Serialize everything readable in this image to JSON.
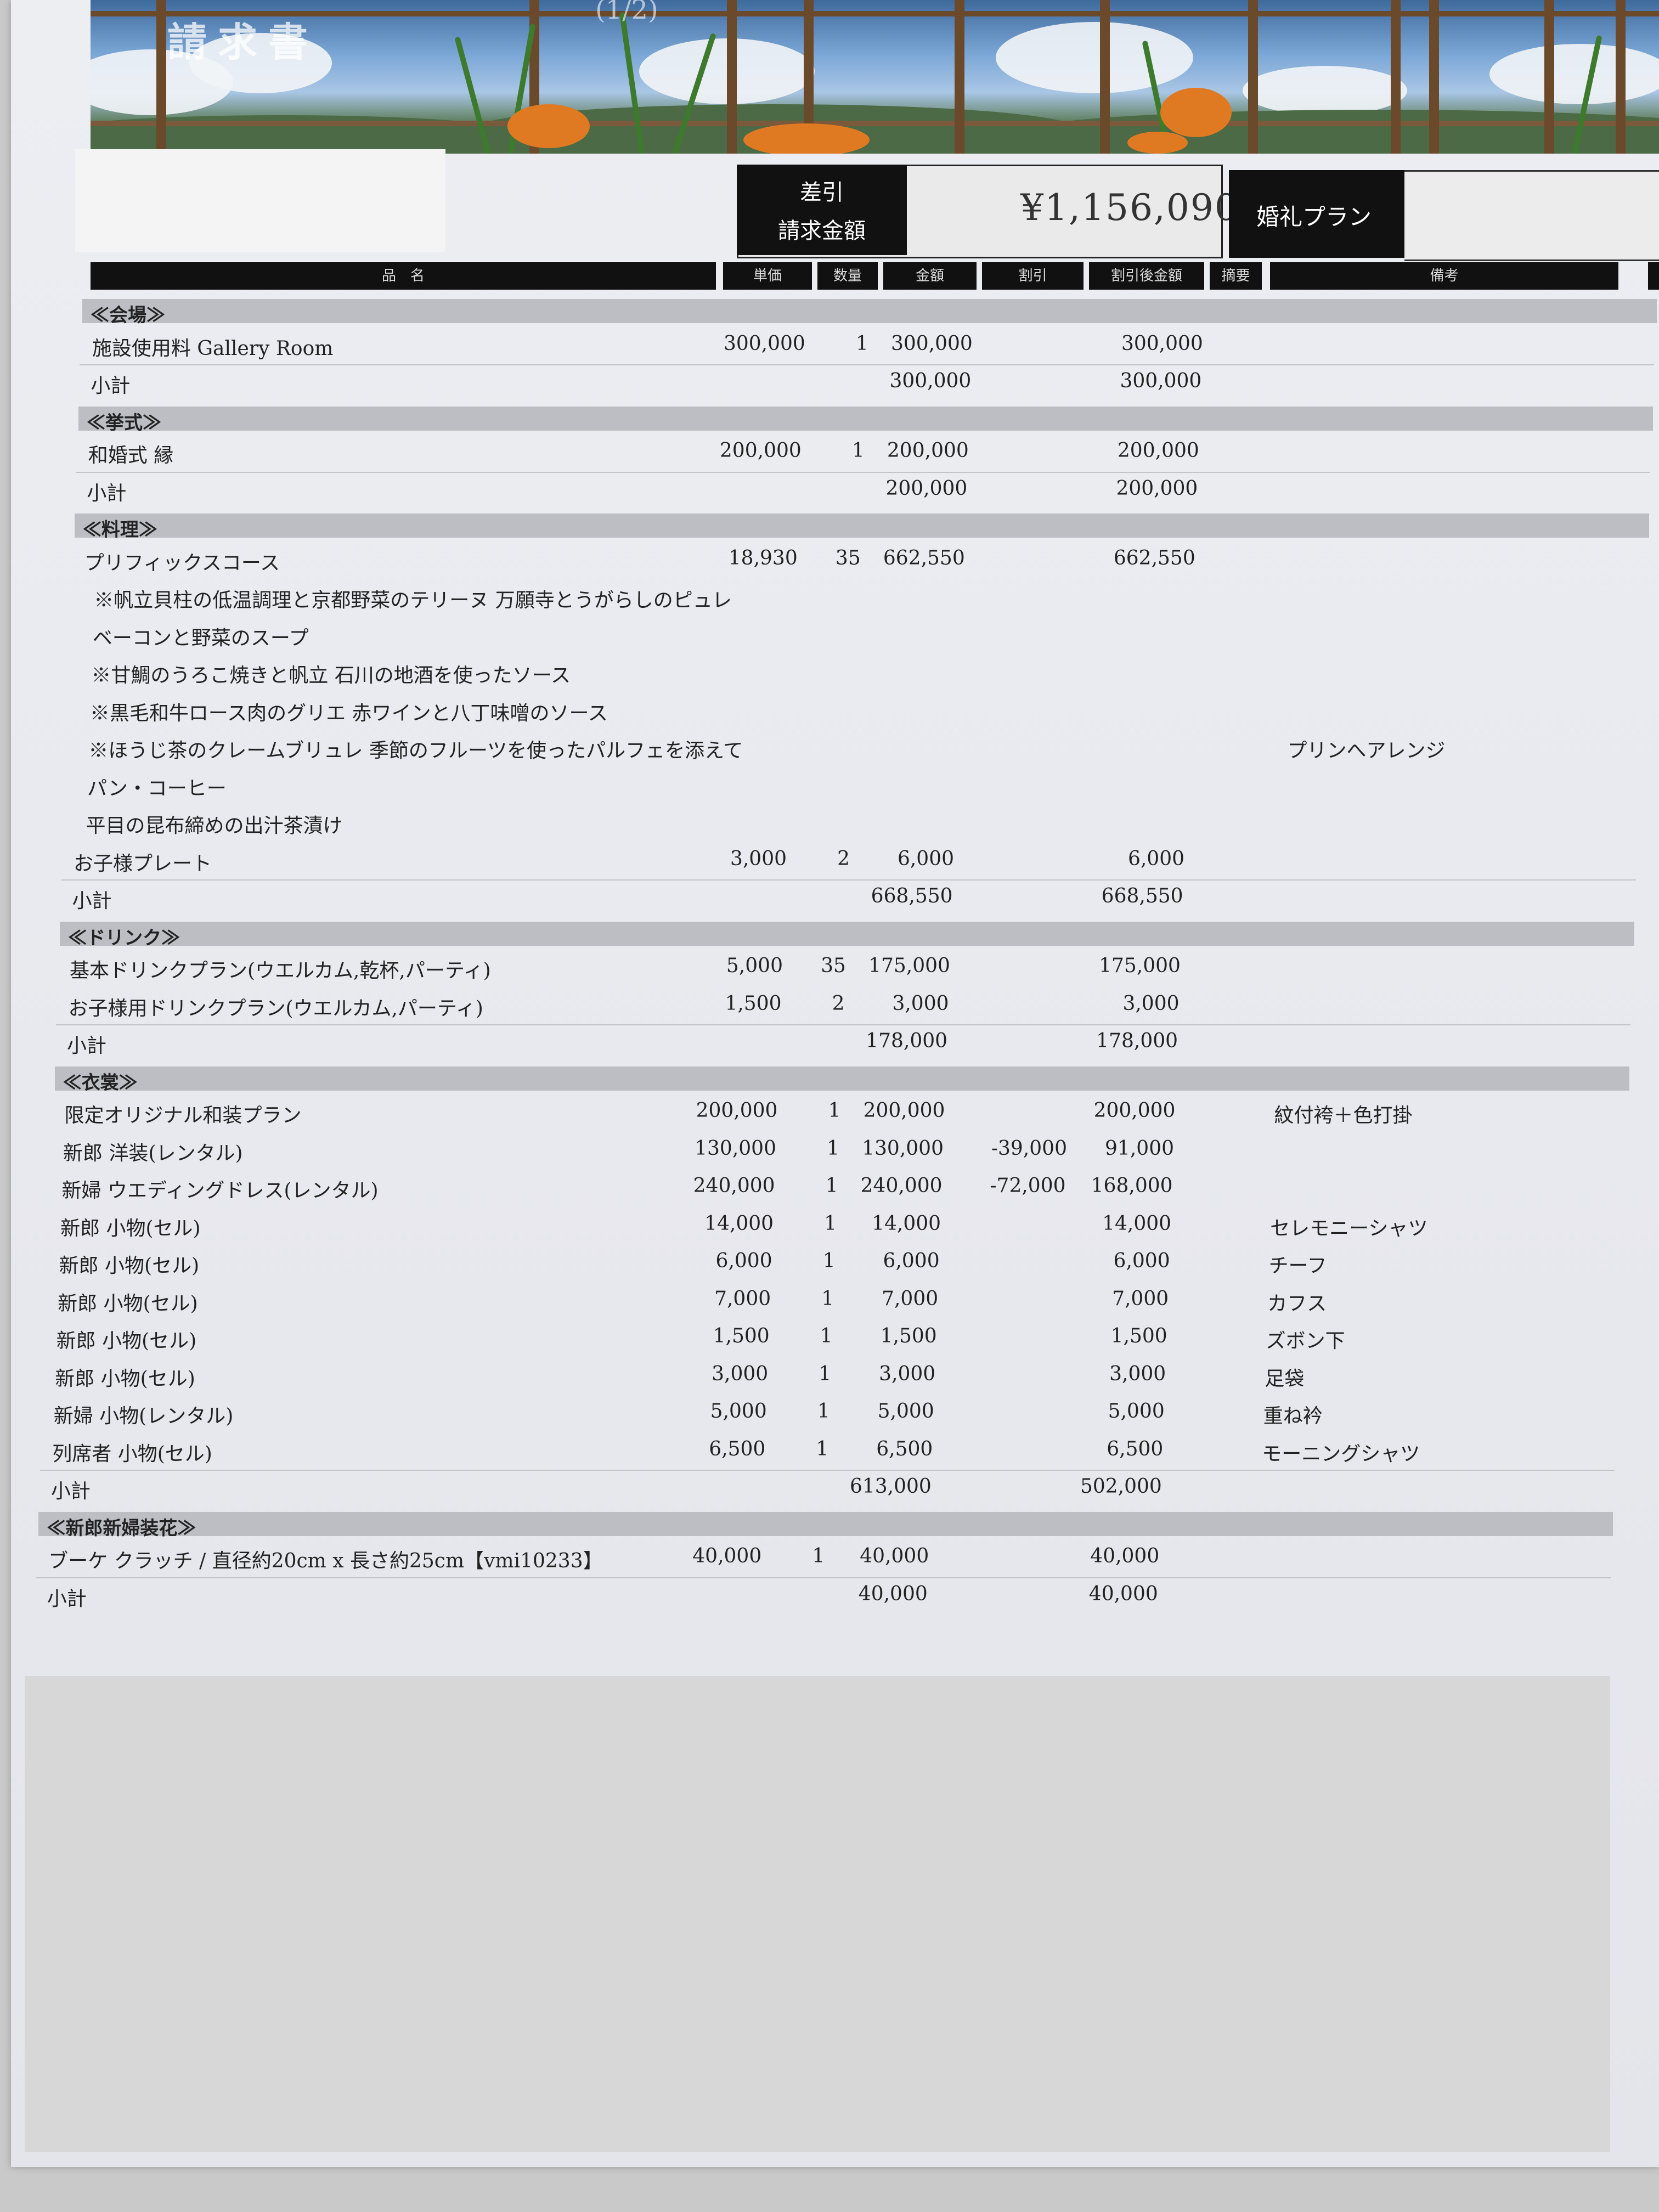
{
  "header": {
    "title": "請求書",
    "page": "(1/2)"
  },
  "summary": {
    "diff_label_1": "差引",
    "diff_label_2": "請求金額",
    "total": "¥1,156,090",
    "plan": "婚礼プラン"
  },
  "columns": {
    "item": "品　名",
    "unit_price": "単価",
    "qty": "数量",
    "amount": "金額",
    "discount": "割引",
    "after_discount": "割引後金額",
    "memo": "摘要",
    "remarks": "備考"
  },
  "sections": [
    {
      "title": "≪会場≫",
      "rows": [
        {
          "name": "施設使用料 Gallery Room",
          "unit": "300,000",
          "qty": "1",
          "amount": "300,000",
          "discount": "",
          "after": "300,000",
          "remark": ""
        }
      ],
      "subtotal": {
        "label": "小計",
        "amount": "300,000",
        "after": "300,000"
      }
    },
    {
      "title": "≪挙式≫",
      "rows": [
        {
          "name": "和婚式 縁",
          "unit": "200,000",
          "qty": "1",
          "amount": "200,000",
          "discount": "",
          "after": "200,000",
          "remark": ""
        }
      ],
      "subtotal": {
        "label": "小計",
        "amount": "200,000",
        "after": "200,000"
      }
    },
    {
      "title": "≪料理≫",
      "rows": [
        {
          "name": "プリフィックスコース",
          "unit": "18,930",
          "qty": "35",
          "amount": "662,550",
          "discount": "",
          "after": "662,550",
          "remark": ""
        },
        {
          "name": "※帆立貝柱の低温調理と京都野菜のテリーヌ 万願寺とうがらしのピュレ",
          "unit": "",
          "qty": "",
          "amount": "",
          "discount": "",
          "after": "",
          "remark": ""
        },
        {
          "name": "ベーコンと野菜のスープ",
          "unit": "",
          "qty": "",
          "amount": "",
          "discount": "",
          "after": "",
          "remark": ""
        },
        {
          "name": "※甘鯛のうろこ焼きと帆立 石川の地酒を使ったソース",
          "unit": "",
          "qty": "",
          "amount": "",
          "discount": "",
          "after": "",
          "remark": ""
        },
        {
          "name": "※黒毛和牛ロース肉のグリエ 赤ワインと八丁味噌のソース",
          "unit": "",
          "qty": "",
          "amount": "",
          "discount": "",
          "after": "",
          "remark": ""
        },
        {
          "name": "※ほうじ茶のクレームブリュレ 季節のフルーツを使ったパルフェを添えて",
          "unit": "",
          "qty": "",
          "amount": "",
          "discount": "",
          "after": "",
          "remark": "プリンへアレンジ"
        },
        {
          "name": "パン・コーヒー",
          "unit": "",
          "qty": "",
          "amount": "",
          "discount": "",
          "after": "",
          "remark": ""
        },
        {
          "name": "平目の昆布締めの出汁茶漬け",
          "unit": "",
          "qty": "",
          "amount": "",
          "discount": "",
          "after": "",
          "remark": ""
        },
        {
          "name": "お子様プレート",
          "unit": "3,000",
          "qty": "2",
          "amount": "6,000",
          "discount": "",
          "after": "6,000",
          "remark": ""
        }
      ],
      "subtotal": {
        "label": "小計",
        "amount": "668,550",
        "after": "668,550"
      }
    },
    {
      "title": "≪ドリンク≫",
      "rows": [
        {
          "name": "基本ドリンクプラン(ウエルカム,乾杯,パーティ)",
          "unit": "5,000",
          "qty": "35",
          "amount": "175,000",
          "discount": "",
          "after": "175,000",
          "remark": ""
        },
        {
          "name": "お子様用ドリンクプラン(ウエルカム,パーティ)",
          "unit": "1,500",
          "qty": "2",
          "amount": "3,000",
          "discount": "",
          "after": "3,000",
          "remark": ""
        }
      ],
      "subtotal": {
        "label": "小計",
        "amount": "178,000",
        "after": "178,000"
      }
    },
    {
      "title": "≪衣裳≫",
      "rows": [
        {
          "name": "限定オリジナル和装プラン",
          "unit": "200,000",
          "qty": "1",
          "amount": "200,000",
          "discount": "",
          "after": "200,000",
          "remark": "紋付袴＋色打掛"
        },
        {
          "name": "新郎 洋装(レンタル)",
          "unit": "130,000",
          "qty": "1",
          "amount": "130,000",
          "discount": "-39,000",
          "after": "91,000",
          "remark": ""
        },
        {
          "name": "新婦 ウエディングドレス(レンタル)",
          "unit": "240,000",
          "qty": "1",
          "amount": "240,000",
          "discount": "-72,000",
          "after": "168,000",
          "remark": ""
        },
        {
          "name": "新郎 小物(セル)",
          "unit": "14,000",
          "qty": "1",
          "amount": "14,000",
          "discount": "",
          "after": "14,000",
          "remark": "セレモニーシャツ"
        },
        {
          "name": "新郎 小物(セル)",
          "unit": "6,000",
          "qty": "1",
          "amount": "6,000",
          "discount": "",
          "after": "6,000",
          "remark": "チーフ"
        },
        {
          "name": "新郎 小物(セル)",
          "unit": "7,000",
          "qty": "1",
          "amount": "7,000",
          "discount": "",
          "after": "7,000",
          "remark": "カフス"
        },
        {
          "name": "新郎 小物(セル)",
          "unit": "1,500",
          "qty": "1",
          "amount": "1,500",
          "discount": "",
          "after": "1,500",
          "remark": "ズボン下"
        },
        {
          "name": "新郎 小物(セル)",
          "unit": "3,000",
          "qty": "1",
          "amount": "3,000",
          "discount": "",
          "after": "3,000",
          "remark": "足袋"
        },
        {
          "name": "新婦 小物(レンタル)",
          "unit": "5,000",
          "qty": "1",
          "amount": "5,000",
          "discount": "",
          "after": "5,000",
          "remark": "重ね衿"
        },
        {
          "name": "列席者 小物(セル)",
          "unit": "6,500",
          "qty": "1",
          "amount": "6,500",
          "discount": "",
          "after": "6,500",
          "remark": "モーニングシャツ"
        }
      ],
      "subtotal": {
        "label": "小計",
        "amount": "613,000",
        "after": "502,000"
      }
    },
    {
      "title": "≪新郎新婦装花≫",
      "rows": [
        {
          "name": "ブーケ クラッチ / 直径約20cm x 長さ約25cm【vmi10233】",
          "unit": "40,000",
          "qty": "1",
          "amount": "40,000",
          "discount": "",
          "after": "40,000",
          "remark": ""
        }
      ],
      "subtotal": {
        "label": "小計",
        "amount": "40,000",
        "after": "40,000"
      }
    }
  ]
}
